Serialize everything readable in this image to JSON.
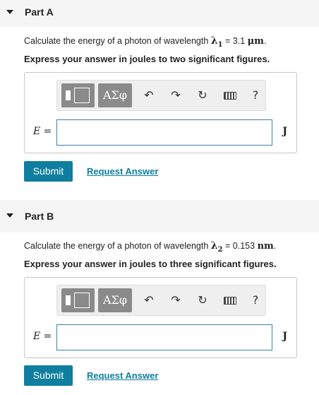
{
  "partA": {
    "title": "Part A",
    "question_prefix": "Calculate the energy of a photon of wavelength ",
    "symbol": "λ",
    "subscript": "1",
    "equals_value": " = 3.1 ",
    "unit": "μm",
    "period": ".",
    "instruction": "Express your answer in joules to two significant figures.",
    "toolbar": {
      "greek_label": "ΑΣφ",
      "undo_icon": "↶",
      "redo_icon": "↷",
      "reset_icon": "↻",
      "help_label": "?"
    },
    "var_label": "E",
    "eq_sign": " =",
    "input_value": "",
    "unit_label": "J",
    "submit_label": "Submit",
    "request_label": "Request Answer"
  },
  "partB": {
    "title": "Part B",
    "question_prefix": "Calculate the energy of a photon of wavelength ",
    "symbol": "λ",
    "subscript": "2",
    "equals_value": " = 0.153 ",
    "unit": "nm",
    "period": ".",
    "instruction": "Express your answer in joules to three significant figures.",
    "toolbar": {
      "greek_label": "ΑΣφ",
      "undo_icon": "↶",
      "redo_icon": "↷",
      "reset_icon": "↻",
      "help_label": "?"
    },
    "var_label": "E",
    "eq_sign": " =",
    "input_value": "",
    "unit_label": "J",
    "submit_label": "Submit",
    "request_label": "Request Answer"
  }
}
